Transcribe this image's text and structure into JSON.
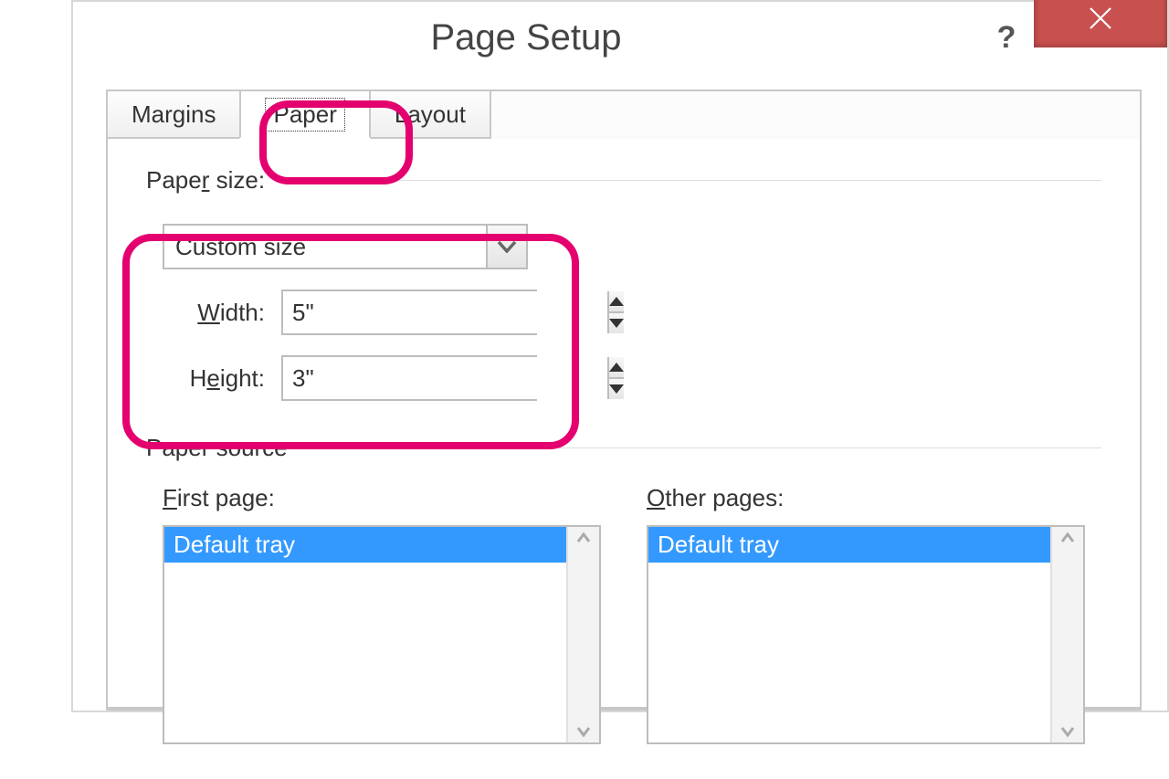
{
  "titlebar": {
    "title": "Page Setup"
  },
  "tabs": {
    "margins": "Margins",
    "paper": "Paper",
    "layout": "Layout"
  },
  "paper_size": {
    "label_pre": "Pape",
    "label_u": "r",
    "label_post": " size:",
    "selected": "Custom size",
    "width_label_u": "W",
    "width_label_post": "idth:",
    "width_value": "5\"",
    "height_label_pre": "H",
    "height_label_u": "e",
    "height_label_post": "ight:",
    "height_value": "3\""
  },
  "paper_source": {
    "label": "Paper source",
    "first_page_label_u": "F",
    "first_page_label_post": "irst page:",
    "other_pages_label_u": "O",
    "other_pages_label_post": "ther pages:",
    "first_page_item": "Default tray",
    "other_pages_item": "Default tray"
  }
}
